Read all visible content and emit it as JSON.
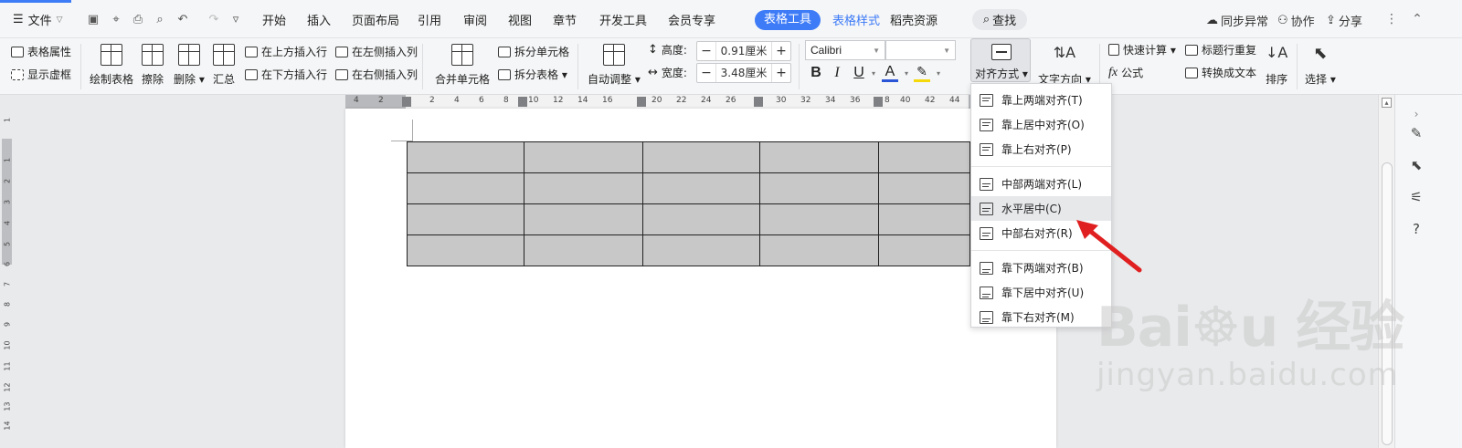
{
  "titlebar": {
    "file_label": "文件",
    "tabs": [
      "开始",
      "插入",
      "页面布局",
      "引用",
      "审阅",
      "视图",
      "章节",
      "开发工具",
      "会员专享"
    ],
    "active_tab": "表格工具",
    "tabs_after": [
      "表格样式",
      "稻壳资源"
    ],
    "search_label": "查找",
    "sync_label": "同步异常",
    "collab_label": "协作",
    "share_label": "分享"
  },
  "ribbon": {
    "table_props": "表格属性",
    "show_gridlines": "显示虚框",
    "draw_table": "绘制表格",
    "erase": "擦除",
    "delete": "删除",
    "summary": "汇总",
    "insert_above": "在上方插入行",
    "insert_below": "在下方插入行",
    "insert_left": "在左侧插入列",
    "insert_right": "在右侧插入列",
    "merge_cells": "合并单元格",
    "split_cells": "拆分单元格",
    "split_table": "拆分表格",
    "auto_adjust": "自动调整",
    "height_label": "高度:",
    "height_value": "0.91厘米",
    "width_label": "宽度:",
    "width_value": "3.48厘米",
    "font_name": "Calibri",
    "font_size": "",
    "align_label": "对齐方式",
    "text_direction": "文字方向",
    "quick_calc": "快速计算",
    "formula": "公式",
    "repeat_header": "标题行重复",
    "convert_text": "转换成文本",
    "sort": "排序",
    "select": "选择"
  },
  "ruler": {
    "h_labels": [
      "4",
      "2",
      "2",
      "4",
      "6",
      "8",
      "10",
      "12",
      "14",
      "16",
      "20",
      "22",
      "24",
      "26",
      "30",
      "32",
      "34",
      "36",
      "8",
      "40",
      "42",
      "44"
    ],
    "v_labels": [
      "1",
      "1",
      "2",
      "3",
      "4",
      "5",
      "6",
      "7",
      "8",
      "9",
      "10",
      "11",
      "12",
      "13",
      "14"
    ]
  },
  "table": {
    "rows": 4,
    "cols": 5
  },
  "align_menu": {
    "items": [
      {
        "label": "靠上两端对齐(T)",
        "icon": "align-top-justify-icon"
      },
      {
        "label": "靠上居中对齐(O)",
        "icon": "align-top-center-icon"
      },
      {
        "label": "靠上右对齐(P)",
        "icon": "align-top-right-icon"
      },
      {
        "label": "中部两端对齐(L)",
        "icon": "align-middle-justify-icon"
      },
      {
        "label": "水平居中(C)",
        "icon": "align-middle-center-icon"
      },
      {
        "label": "中部右对齐(R)",
        "icon": "align-middle-right-icon"
      },
      {
        "label": "靠下两端对齐(B)",
        "icon": "align-bottom-justify-icon"
      },
      {
        "label": "靠下居中对齐(U)",
        "icon": "align-bottom-center-icon"
      },
      {
        "label": "靠下右对齐(M)",
        "icon": "align-bottom-right-icon"
      }
    ],
    "highlighted": "水平居中(C)"
  },
  "watermark": {
    "main": "Bai",
    "brand": "经验",
    "sub": "jingyan.baidu.com"
  },
  "colors": {
    "accent": "#3d7bf7",
    "arrow": "#e02020",
    "cell_fill": "#c8c8c8"
  }
}
